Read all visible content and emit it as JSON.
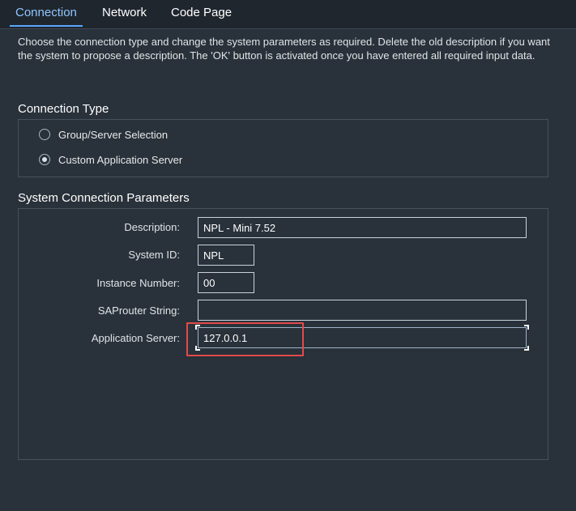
{
  "tabs": [
    {
      "label": "Connection",
      "active": true
    },
    {
      "label": "Network",
      "active": false
    },
    {
      "label": "Code Page",
      "active": false
    }
  ],
  "intro_text": "Choose the connection type and change the system parameters as required. Delete the old description if you want the system to propose a description. The 'OK' button is activated once you have entered all required input data.",
  "connection_type": {
    "title": "Connection Type",
    "options": [
      {
        "label": "Group/Server Selection",
        "checked": false
      },
      {
        "label": "Custom Application Server",
        "checked": true
      }
    ]
  },
  "system_params": {
    "title": "System Connection Parameters",
    "fields": {
      "description": {
        "label": "Description:",
        "value": "NPL - Mini 7.52"
      },
      "system_id": {
        "label": "System ID:",
        "value": "NPL"
      },
      "instance_number": {
        "label": "Instance Number:",
        "value": "00"
      },
      "saprouter": {
        "label": "SAProuter String:",
        "value": ""
      },
      "app_server": {
        "label": "Application Server:",
        "value": "127.0.0.1"
      }
    }
  },
  "colors": {
    "background": "#29313a",
    "tab_active": "#8fc7ff",
    "highlight": "#e24a4a"
  }
}
